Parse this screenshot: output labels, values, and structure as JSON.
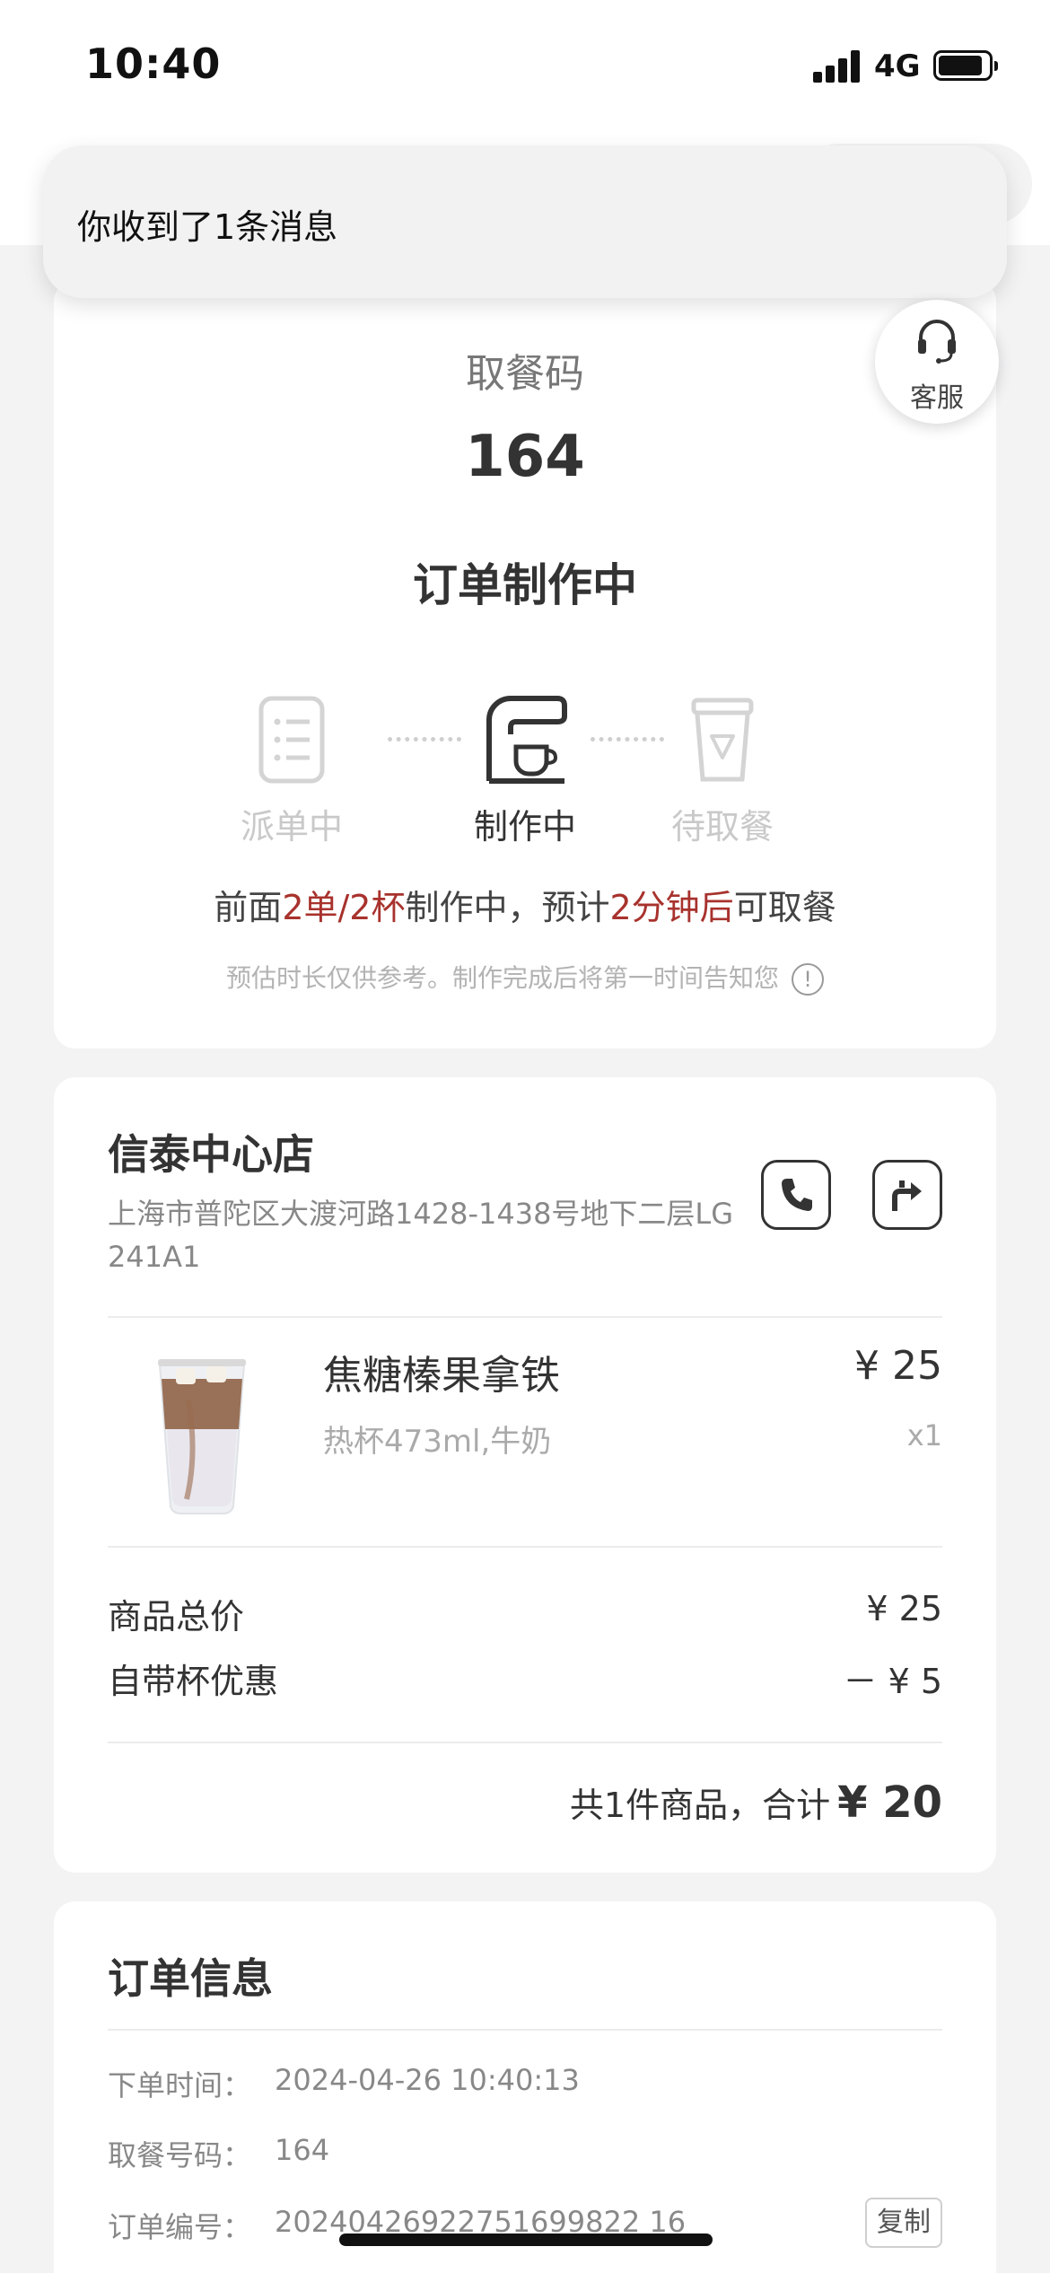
{
  "status_bar": {
    "time": "10:40",
    "network": "4G"
  },
  "notification": {
    "text": "你收到了1条消息"
  },
  "service": {
    "label": "客服"
  },
  "pickup": {
    "label": "取餐码",
    "code": "164",
    "status": "订单制作中",
    "steps": [
      {
        "label": "派单中",
        "state": "done"
      },
      {
        "label": "制作中",
        "state": "active"
      },
      {
        "label": "待取餐",
        "state": "pending"
      }
    ],
    "eta": {
      "prefix": "前面",
      "queue": "2单/2杯",
      "middle": "制作中，预计",
      "time": "2分钟后",
      "suffix": "可取餐"
    },
    "hint": "预估时长仅供参考。制作完成后将第一时间告知您",
    "info_icon": "!"
  },
  "store": {
    "name": "信泰中心店",
    "address": "上海市普陀区大渡河路1428-1438号地下二层LG241A1"
  },
  "product": {
    "name": "焦糖榛果拿铁",
    "spec": "热杯473ml,牛奶",
    "price": "¥ 25",
    "qty": "x1"
  },
  "summary": {
    "subtotal_label": "商品总价",
    "subtotal_value": "¥ 25",
    "discount_label": "自带杯优惠",
    "discount_value": "－ ¥ 5",
    "total_prefix": "共1件商品，合计",
    "total_value": "¥ 20"
  },
  "order_info": {
    "title": "订单信息",
    "rows": [
      {
        "key": "下单时间：",
        "value": "2024-04-26 10:40:13"
      },
      {
        "key": "取餐号码：",
        "value": "164"
      },
      {
        "key": "订单编号：",
        "value": "20240426922751699822 16"
      }
    ],
    "copy_label": "复制"
  },
  "colors": {
    "accent_red": "#a8322d",
    "background": "#f3f3f4"
  }
}
